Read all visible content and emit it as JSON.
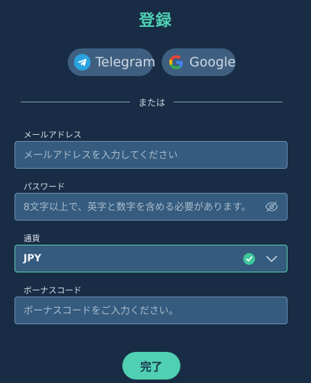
{
  "title": "登録",
  "social": {
    "telegram_label": "Telegram",
    "google_label": "Google"
  },
  "divider_text": "または",
  "fields": {
    "email": {
      "label": "メールアドレス",
      "placeholder": "メールアドレスを入力してください"
    },
    "password": {
      "label": "パスワード",
      "placeholder": "8文字以上で、英字と数字を含める必要があります。"
    },
    "currency": {
      "label": "通貨",
      "value": "JPY"
    },
    "bonus": {
      "label": "ボーナスコード",
      "placeholder": "ボーナスコードをご入力ください。"
    }
  },
  "submit_label": "完了",
  "icons": {
    "telegram": "telegram-icon",
    "google": "google-icon",
    "password_toggle": "eye-off-icon",
    "valid": "check-circle-icon",
    "dropdown": "chevron-down-icon"
  },
  "colors": {
    "background": "#182d45",
    "accent": "#4fd1b4",
    "field_bg": "#355b7e",
    "field_border": "#6f93b8",
    "valid_border": "#5ed6b3"
  }
}
